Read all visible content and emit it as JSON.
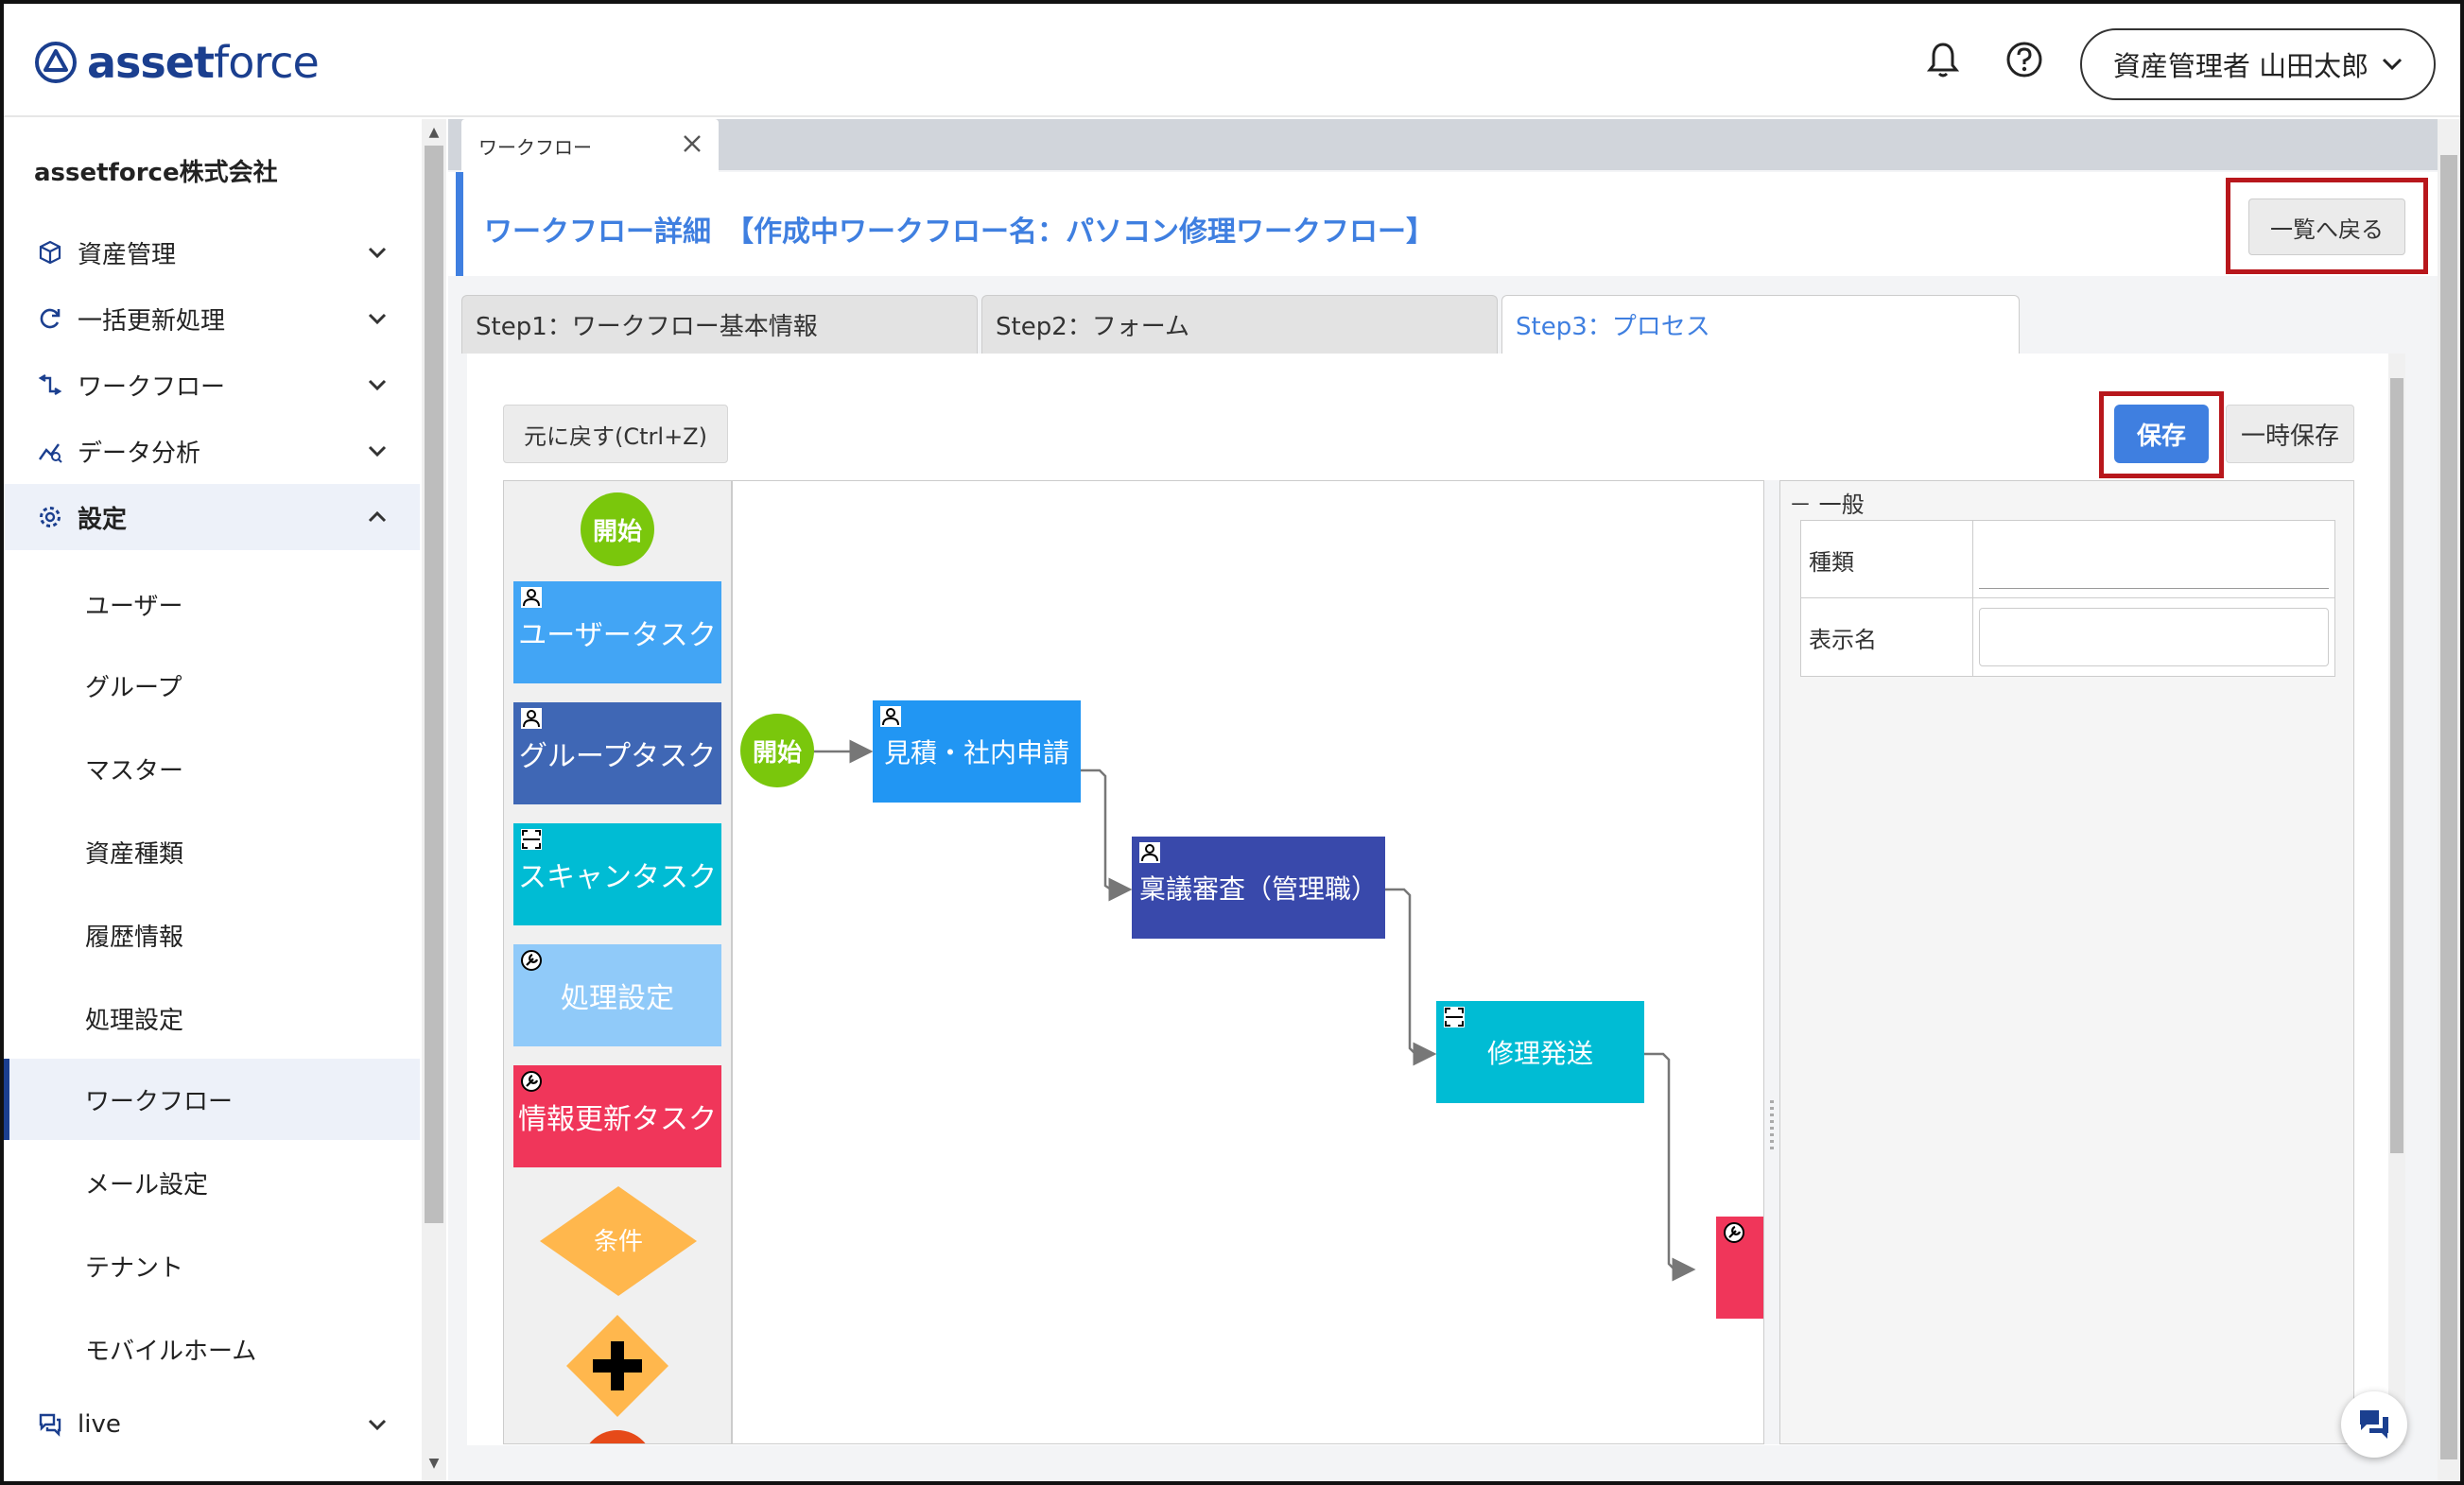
{
  "header": {
    "logo_bold": "asset",
    "logo_light": "force",
    "user_label": "資産管理者 山田太郎"
  },
  "sidebar": {
    "company": "assetforce株式会社",
    "items": [
      {
        "label": "資産管理",
        "icon": "cube-icon"
      },
      {
        "label": "一括更新処理",
        "icon": "refresh-icon"
      },
      {
        "label": "ワークフロー",
        "icon": "workflow-icon"
      },
      {
        "label": "データ分析",
        "icon": "analytics-icon"
      },
      {
        "label": "設定",
        "icon": "gear-icon"
      }
    ],
    "settings_sub": [
      "ユーザー",
      "グループ",
      "マスター",
      "資産種類",
      "履歴情報",
      "処理設定",
      "ワークフロー",
      "メール設定",
      "テナント",
      "モバイルホーム"
    ],
    "live_label": "live"
  },
  "tabs": {
    "doc_tab": "ワークフロー"
  },
  "page": {
    "title": "ワークフロー詳細　【作成中ワークフロー名：パソコン修理ワークフロー】",
    "back_button": "一覧へ戻る"
  },
  "steps": [
    "Step1：ワークフロー基本情報",
    "Step2：フォーム",
    "Step3：プロセス"
  ],
  "toolbar": {
    "undo": "元に戻す(Ctrl+Z)",
    "save": "保存",
    "temp_save": "一時保存"
  },
  "palette": {
    "start": "開始",
    "user_task": "ユーザータスク",
    "group_task": "グループタスク",
    "scan_task": "スキャンタスク",
    "process_setting": "処理設定",
    "info_update_task": "情報更新タスク",
    "condition": "条件"
  },
  "workflow": {
    "start": "開始",
    "nodes": [
      "見積・社内申請",
      "稟議審査（管理職）",
      "修理発送"
    ]
  },
  "properties": {
    "section": "一般",
    "fields": [
      {
        "label": "種類",
        "value": ""
      },
      {
        "label": "表示名",
        "value": ""
      }
    ]
  },
  "colors": {
    "brand": "#1b3f8f",
    "accent": "#3f7fe0",
    "user_task": "#42a5f5",
    "group_task": "#3f67b5",
    "scan_task": "#00bcd4",
    "process_setting": "#90caf9",
    "info_update": "#f0365a",
    "condition": "#ffb74d",
    "start": "#7ac70c",
    "highlight_box": "#b8171c"
  }
}
